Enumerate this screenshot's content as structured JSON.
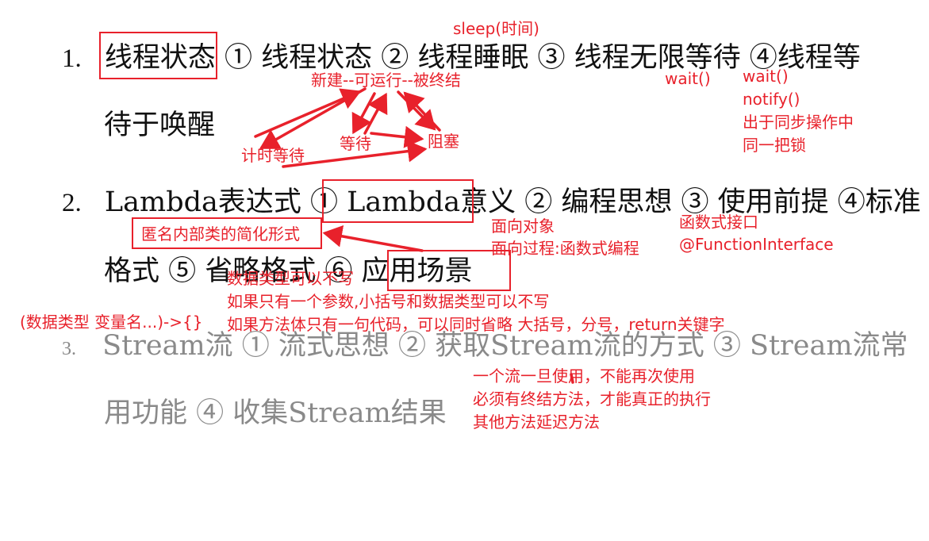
{
  "colors": {
    "annotation": "#e8212b",
    "text": "#111111",
    "muted": "#8a8a8a"
  },
  "items": [
    {
      "number": "1.",
      "line1": [
        "线程状态",
        " ① 线程状态 ② 线程睡眠 ③ 线程无限等待 ④线程等"
      ],
      "line2": "待于唤醒"
    },
    {
      "number": "2.",
      "line1_a": "Lambda表达式 ① ",
      "line1_b": "Lambda意义",
      "line1_c": " ② 编程思想 ③ 使用前提 ④标准",
      "line2_a": "格式 ⑤ 省略格式 ⑥ ",
      "line2_b": "应用场景"
    },
    {
      "number": "3.",
      "line1": "Stream流 ① 流式思想 ② 获取Stream流的方式 ③ Stream流常",
      "line2": "用功能 ④ 收集Stream结果"
    }
  ],
  "annotations": {
    "sleep": "sleep(时间)",
    "lifecycle": "新建--可运行--被终结",
    "wait_left": "wait()",
    "wait_right": "wait()",
    "notify": "notify()",
    "sync": "出于同步操作中",
    "same_lock": "同一把锁",
    "timed_wait": "计时等待",
    "waiting": "等待",
    "blocked": "阻塞",
    "anonymous": "匿名内部类的简化形式",
    "oop": "面向对象",
    "functional": "面向过程:函数式编程",
    "func_interface": "函数式接口",
    "func_annotation": "@FunctionInterface",
    "omit1": "数据类型可以不写",
    "omit2": "如果只有一个参数,小括号和数据类型可以不写",
    "omit3": "如果方法体只有一句代码，可以同时省略  大括号，分号，return关键字",
    "standard_format": "(数据类型 变量名...)->{}",
    "stream1": "一个流一旦使用，不能再次使用",
    "stream2": "必须有终结方法，才能真正的执行",
    "stream3": "其他方法延迟方法"
  }
}
